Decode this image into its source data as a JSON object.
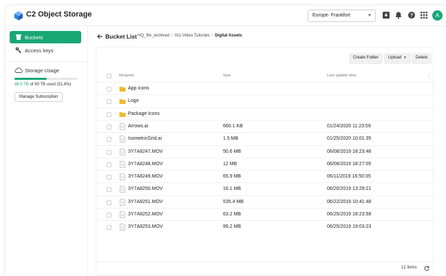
{
  "app": {
    "title": "C2 Object Storage",
    "avatar_initial": "A"
  },
  "topbar": {
    "region": "Europe- Frankfort"
  },
  "sidebar": {
    "items": [
      {
        "label": "Buckets",
        "active": true
      },
      {
        "label": "Access keys",
        "active": false
      }
    ],
    "usage": {
      "title": "Storage Usage",
      "used": "46.5 TB",
      "rest": "of 90 TB used (51.6%)",
      "percent": 51.6,
      "manage_label": "Manage Subscription"
    }
  },
  "header": {
    "title": "Bucket List",
    "breadcrumbs": [
      "HQ_file_archived",
      "011.Video Tutorials",
      "Digital Assets"
    ]
  },
  "toolbar": {
    "create_folder": "Create Folder",
    "upload": "Upload",
    "delete": "Delete"
  },
  "table": {
    "columns": {
      "name": "Nmamer",
      "size": "Size",
      "updated": "Last update time",
      "more": "⋮"
    },
    "rows": [
      {
        "type": "folder",
        "name": "App icons",
        "size": "",
        "updated": ""
      },
      {
        "type": "folder",
        "name": "Logo",
        "size": "",
        "updated": ""
      },
      {
        "type": "folder",
        "name": "Package Icons",
        "size": "",
        "updated": ""
      },
      {
        "type": "file",
        "name": "Arrows.ai",
        "size": "660.1 KB",
        "updated": "01/24/2020 11:23:59"
      },
      {
        "type": "file",
        "name": "IsometricGrid.ai",
        "size": "1.5 MB",
        "updated": "01/25/2020 10:01:35"
      },
      {
        "type": "file",
        "name": "3Y7A8247.MOV",
        "size": "50.6 MB",
        "updated": "06/08/2019 18:23:48"
      },
      {
        "type": "file",
        "name": "3Y7A8248.MOV",
        "size": "12 MB",
        "updated": "06/08/2019 18:27:05"
      },
      {
        "type": "file",
        "name": "3Y7A8249.MOV",
        "size": "65.9 MB",
        "updated": "06/11/2019 16:50:35"
      },
      {
        "type": "file",
        "name": "3Y7A8250.MOV",
        "size": "16.1 MB",
        "updated": "06/20/2019 13:29:21"
      },
      {
        "type": "file",
        "name": "3Y7A8251.MOV",
        "size": "535.4 MB",
        "updated": "06/22/2019 10:41:48"
      },
      {
        "type": "file",
        "name": "3Y7A8252.MOV",
        "size": "63.2 MB",
        "updated": "06/25/2019 18:23:58"
      },
      {
        "type": "file",
        "name": "3Y7A8253.MOV",
        "size": "99.2 MB",
        "updated": "06/25/2019 19:03:23"
      }
    ],
    "count_label": "12 items"
  },
  "colors": {
    "accent": "#1aa776",
    "folder": "#f5b82e",
    "file": "#b8b8b8"
  }
}
